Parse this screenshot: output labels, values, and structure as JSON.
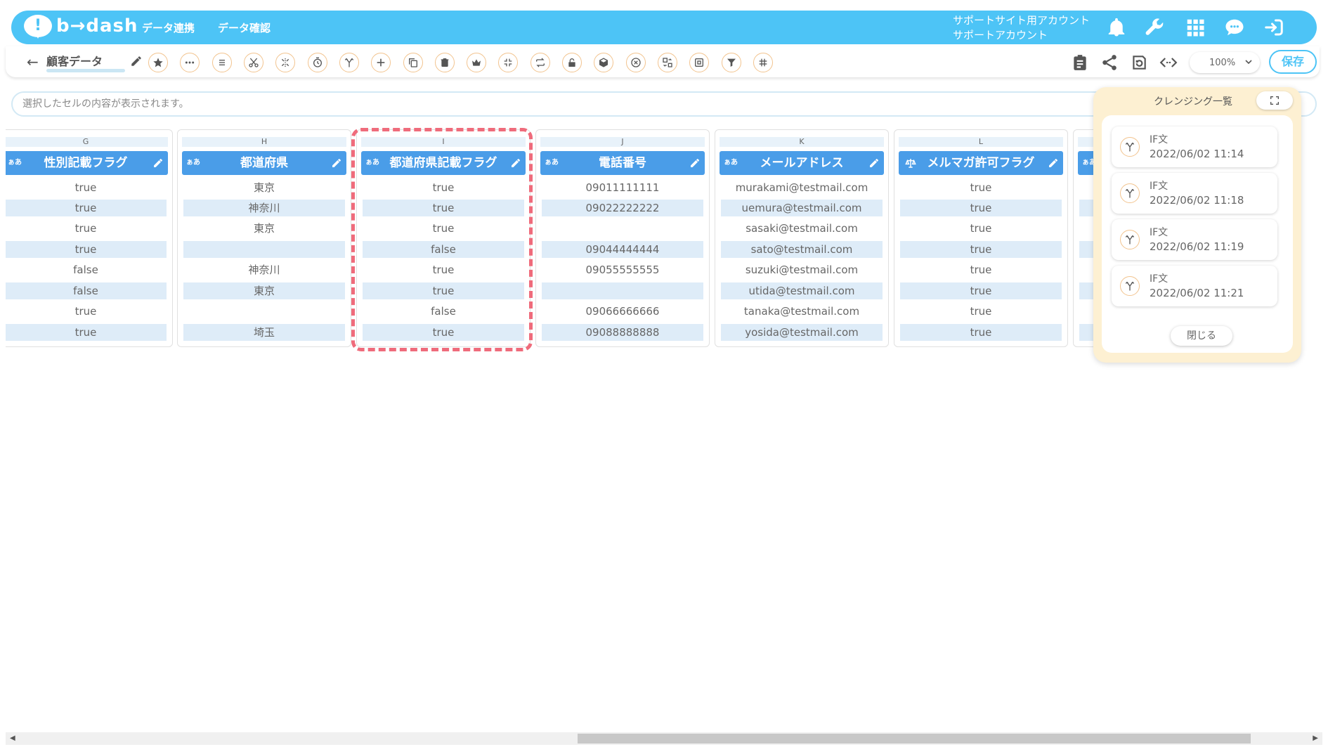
{
  "header": {
    "logo_text": "b→dash",
    "nav": [
      "データ連携",
      "データ確認"
    ],
    "account_line1": "サポートサイト用アカウント",
    "account_line2": "サポートアカウント"
  },
  "toolbar": {
    "title": "顧客データ",
    "zoom": "100%",
    "save_label": "保存"
  },
  "cellbar": {
    "placeholder": "選択したセルの内容が表示されます。"
  },
  "columns": [
    {
      "letter": "G",
      "type": "ぁあ",
      "name": "性別記載フラグ",
      "cells": [
        "true",
        "true",
        "true",
        "true",
        "false",
        "false",
        "true",
        "true"
      ]
    },
    {
      "letter": "H",
      "type": "ぁあ",
      "name": "都道府県",
      "cells": [
        "東京",
        "神奈川",
        "東京",
        "",
        "神奈川",
        "東京",
        "",
        "埼玉"
      ]
    },
    {
      "letter": "I",
      "type": "ぁあ",
      "name": "都道府県記載フラグ",
      "cells": [
        "true",
        "true",
        "true",
        "false",
        "true",
        "true",
        "false",
        "true"
      ]
    },
    {
      "letter": "J",
      "type": "ぁあ",
      "name": "電話番号",
      "cells": [
        "09011111111",
        "09022222222",
        "",
        "09044444444",
        "09055555555",
        "",
        "09066666666",
        "09088888888"
      ]
    },
    {
      "letter": "K",
      "type": "ぁあ",
      "name": "メールアドレス",
      "cells": [
        "murakami@testmail.com",
        "uemura@testmail.com",
        "sasaki@testmail.com",
        "sato@testmail.com",
        "suzuki@testmail.com",
        "utida@testmail.com",
        "tanaka@testmail.com",
        "yosida@testmail.com"
      ]
    },
    {
      "letter": "L",
      "type": "",
      "name": "メルマガ許可フラグ",
      "cells": [
        "true",
        "true",
        "true",
        "true",
        "true",
        "true",
        "true",
        "true"
      ]
    }
  ],
  "partial_column": {
    "type": "ぁあ"
  },
  "panel": {
    "title": "クレンジング一覧",
    "items": [
      {
        "name": "IF文",
        "date": "2022/06/02 11:14"
      },
      {
        "name": "IF文",
        "date": "2022/06/02 11:18"
      },
      {
        "name": "IF文",
        "date": "2022/06/02 11:19"
      },
      {
        "name": "IF文",
        "date": "2022/06/02 11:21"
      }
    ],
    "close_label": "閉じる"
  },
  "colors": {
    "brand": "#4dc4f6",
    "header_blue": "#4a9de8",
    "row_alt": "#deecf8",
    "highlight_dash": "#ef6b7b",
    "panel_bg": "#fdf0d2",
    "tool_ring": "#f2c48f"
  },
  "icons": {
    "top": [
      "bell-icon",
      "wrench-icon",
      "grid-icon",
      "chat-icon",
      "logout-icon"
    ],
    "tools": [
      "star-icon",
      "more-icon",
      "list-icon",
      "scissors-icon",
      "split-icon",
      "timer-icon",
      "branch-icon",
      "plus-icon",
      "copy-icon",
      "trash-icon",
      "crown-icon",
      "collapse-icon",
      "loop-icon",
      "lock-icon",
      "package-icon",
      "cancel-icon",
      "convert-icon",
      "frame-icon",
      "filter-icon",
      "hash-icon"
    ],
    "right": [
      "clipboard-icon",
      "share-icon",
      "history-icon",
      "code-icon"
    ]
  }
}
